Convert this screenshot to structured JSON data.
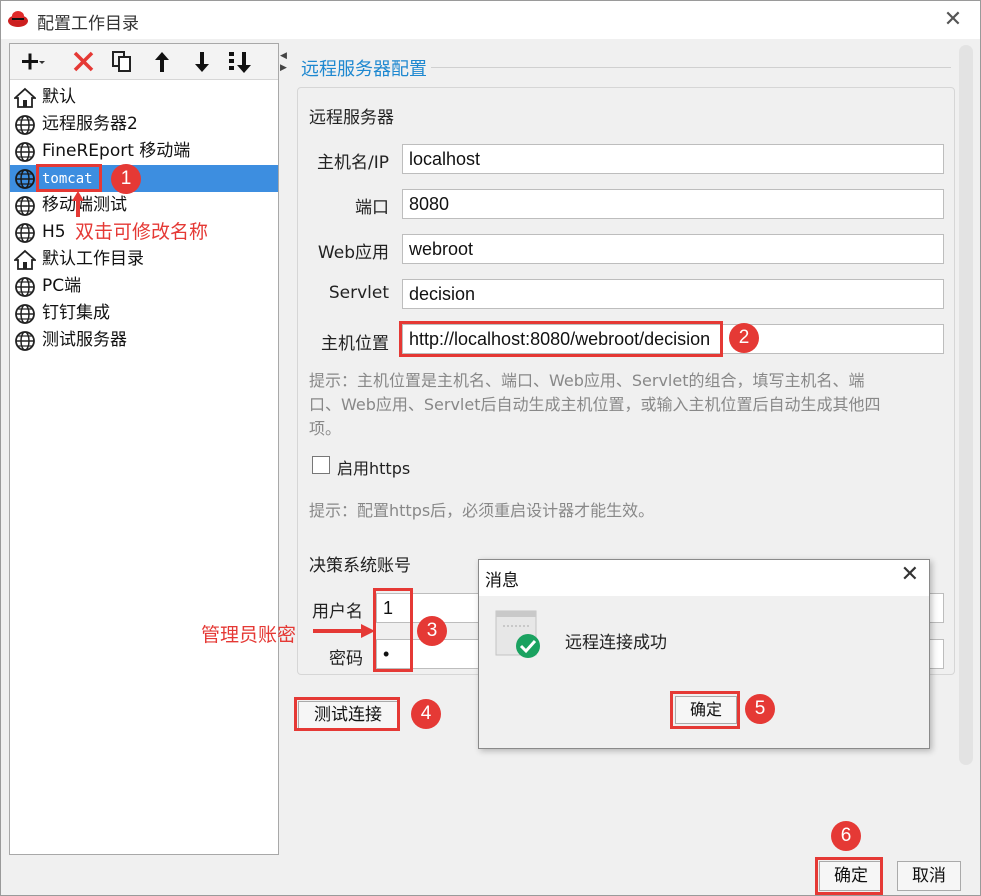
{
  "window": {
    "title": "配置工作目录"
  },
  "toolbar": {
    "icons": [
      "add-dropdown-icon",
      "delete-icon",
      "copy-icon",
      "move-up-icon",
      "move-down-icon",
      "sort-icon"
    ]
  },
  "tree": {
    "items": [
      {
        "label": "默认",
        "icon": "home-icon"
      },
      {
        "label": "远程服务器2",
        "icon": "globe-icon"
      },
      {
        "label": "FineREport 移动端",
        "icon": "globe-icon"
      },
      {
        "label": "tomcat",
        "icon": "globe-icon",
        "selected": true
      },
      {
        "label": "移动端测试",
        "icon": "globe-icon"
      },
      {
        "label": "H5",
        "icon": "globe-icon"
      },
      {
        "label": "默认工作目录",
        "icon": "home-icon"
      },
      {
        "label": "PC端",
        "icon": "globe-icon"
      },
      {
        "label": "钉钉集成",
        "icon": "globe-icon"
      },
      {
        "label": "测试服务器",
        "icon": "globe-icon"
      }
    ]
  },
  "config": {
    "section_title": "远程服务器配置",
    "group_title": "远程服务器",
    "host_label": "主机名/IP",
    "host_value": "localhost",
    "port_label": "端口",
    "port_value": "8080",
    "webapp_label": "Web应用",
    "webapp_value": "webroot",
    "servlet_label": "Servlet",
    "servlet_value": "decision",
    "location_label": "主机位置",
    "location_value": "http://localhost:8080/webroot/decision",
    "hint1_line1": "提示：主机位置是主机名、端口、Web应用、Servlet的组合，填写主机名、端",
    "hint1_line2": "口、Web应用、Servlet后自动生成主机位置，或输入主机位置后自动生成其他四",
    "hint1_line3": "项。",
    "https_label": "启用https",
    "hint2": "提示：配置https后，必须重启设计器才能生效。",
    "account_title": "决策系统账号",
    "username_label": "用户名",
    "username_value": "1",
    "password_label": "密码",
    "password_value": "•",
    "test_button": "测试连接"
  },
  "dialog": {
    "title": "消息",
    "message": "远程连接成功",
    "ok_button": "确定"
  },
  "footer": {
    "ok_button": "确定",
    "cancel_button": "取消"
  },
  "annotations": {
    "rename_hint": "双击可修改名称",
    "admin_hint": "管理员账密",
    "badges": [
      "1",
      "2",
      "3",
      "4",
      "5",
      "6"
    ]
  },
  "colors": {
    "accent": "#1e88d0",
    "selection": "#3d8ee0",
    "annotation": "#e53935"
  }
}
